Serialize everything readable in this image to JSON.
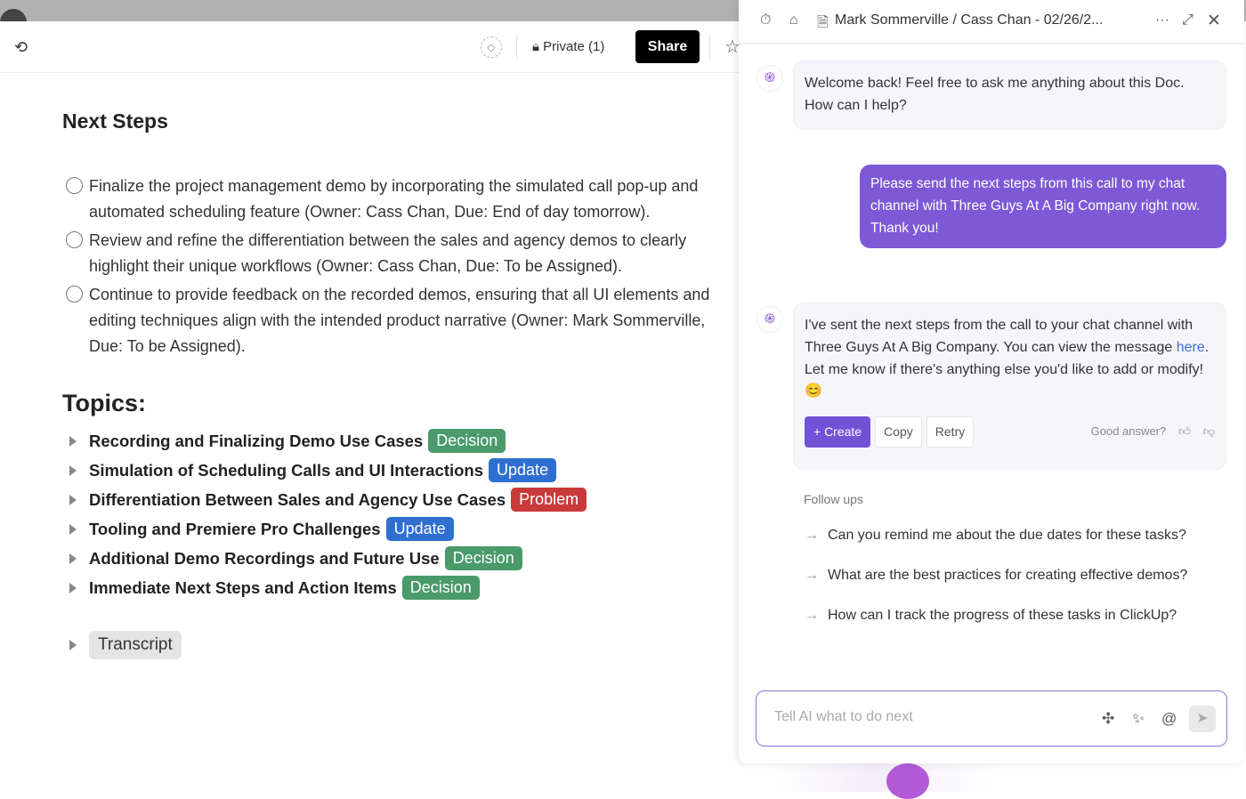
{
  "toolbar": {
    "private_label": "Private (1)",
    "share_label": "Share"
  },
  "doc": {
    "next_steps_title": "Next Steps",
    "steps": [
      {
        "line1": "Finalize the project management demo by incorporating the simulated call pop-up and",
        "line2": "automated scheduling feature (Owner: Cass Chan, Due: End of day tomorrow)."
      },
      {
        "line1": "Review and refine the differentiation between the sales and agency demos to clearly",
        "line2": "highlight their unique workflows (Owner: Cass Chan, Due: To be Assigned)."
      },
      {
        "line1": "Continue to provide feedback on the recorded demos, ensuring that all UI elements and",
        "line2": "editing techniques align with the intended product narrative (Owner: Mark Sommerville,",
        "line3": "Due: To be Assigned)."
      }
    ],
    "topics_title": "Topics:",
    "topics": [
      {
        "label": "Recording and Finalizing Demo Use Cases",
        "badge": "Decision",
        "color": "#4a9a6a"
      },
      {
        "label": "Simulation of Scheduling Calls and UI Interactions",
        "badge": "Update",
        "color": "#2f6fd0"
      },
      {
        "label": "Differentiation Between Sales and Agency Use Cases",
        "badge": "Problem",
        "color": "#c93a3a"
      },
      {
        "label": "Tooling and Premiere Pro Challenges",
        "badge": "Update",
        "color": "#2f6fd0"
      },
      {
        "label": "Additional Demo Recordings and Future Use",
        "badge": "Decision",
        "color": "#4a9a6a"
      },
      {
        "label": "Immediate Next Steps and Action Items",
        "badge": "Decision",
        "color": "#4a9a6a"
      }
    ],
    "transcript_label": "Transcript"
  },
  "panel": {
    "title": "Mark Sommerville / Cass Chan - 02/26/2...",
    "welcome": "Welcome back! Feel free to ask me anything about this Doc. How can I help?",
    "user_message": "Please send the next steps from this call to my chat channel with Three Guys At A Big Company right now. Thank you!",
    "reply_before": "I've sent the next steps from the call to your chat channel with Three Guys At A Big Company. You can view the message ",
    "reply_link": "here",
    "reply_after": ". Let me know if there's anything else you'd like to add or modify! 😊",
    "create_label": "+ Create",
    "copy_label": "Copy",
    "retry_label": "Retry",
    "good_answer": "Good answer?",
    "followups_title": "Follow ups",
    "followups": [
      "Can you remind me about the due dates for these tasks?",
      "What are the best practices for creating effective demos?",
      "How can I track the progress of these tasks in ClickUp?"
    ],
    "input_placeholder": "Tell AI what to do next"
  }
}
